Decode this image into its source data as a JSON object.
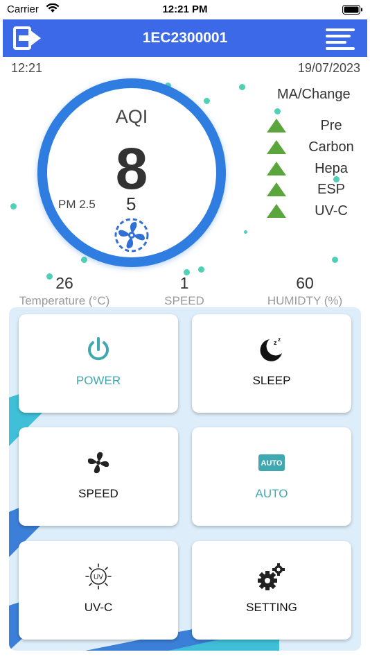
{
  "status_bar": {
    "carrier": "Carrier",
    "time": "12:21 PM"
  },
  "header": {
    "title": "1EC2300001",
    "color": "#3b69e8"
  },
  "info": {
    "time": "12:21",
    "date": "19/07/2023"
  },
  "gauge": {
    "label": "AQI",
    "value": "8",
    "pm_label": "PM 2.5",
    "pm_value": "5",
    "ring_color": "#2f7de0"
  },
  "filters": {
    "title": "MA/Change",
    "items": [
      {
        "name": "Pre"
      },
      {
        "name": "Carbon"
      },
      {
        "name": "Hepa"
      },
      {
        "name": "ESP"
      },
      {
        "name": "UV-C"
      }
    ],
    "indicator_color": "#5aa63c"
  },
  "stats": [
    {
      "value": "26",
      "label": "Temperature (°C)"
    },
    {
      "value": "1",
      "label": "SPEED"
    },
    {
      "value": "60",
      "label": "HUMIDTY (%)"
    }
  ],
  "controls": [
    {
      "label": "POWER",
      "icon": "power-icon"
    },
    {
      "label": "SLEEP",
      "icon": "moon-icon"
    },
    {
      "label": "SPEED",
      "icon": "fan-icon"
    },
    {
      "label": "AUTO",
      "icon": "auto-icon",
      "icon_text": "AUTO"
    },
    {
      "label": "UV-C",
      "icon": "uv-icon",
      "icon_text": "UV"
    },
    {
      "label": "SETTING",
      "icon": "gears-icon"
    }
  ],
  "accent_teal": "#40a8b0"
}
